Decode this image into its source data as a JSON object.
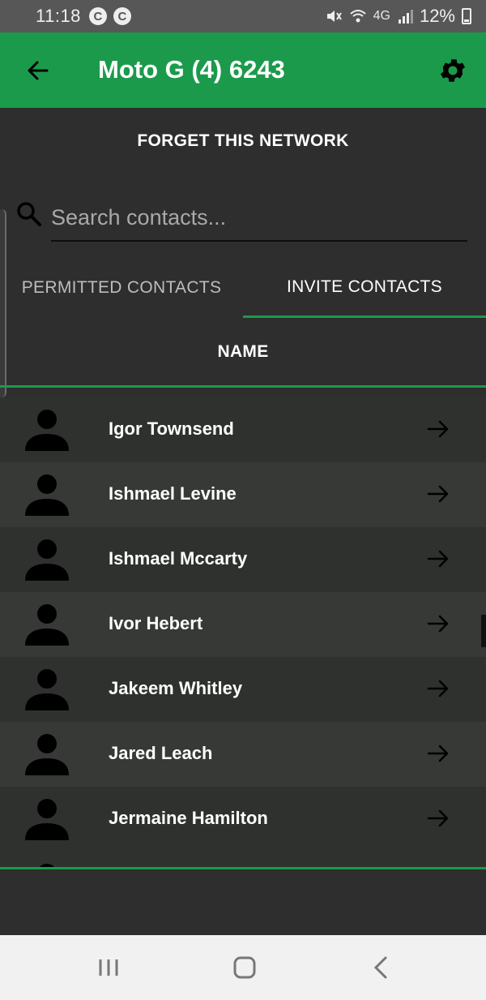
{
  "status_bar": {
    "time": "11:18",
    "network": "4G",
    "battery": "12%",
    "icons": [
      "c-notification-icon",
      "c-notification-icon",
      "mute-icon",
      "wifi-icon",
      "signal-icon",
      "battery-charging-icon"
    ]
  },
  "app_bar": {
    "title": "Moto G (4) 6243",
    "color": "#1b9a4b",
    "icons": [
      "back-arrow-icon",
      "gear-icon"
    ]
  },
  "forget_button": {
    "label": "FORGET THIS NETWORK"
  },
  "search": {
    "placeholder": "Search contacts...",
    "value": ""
  },
  "tabs": [
    {
      "label": "PERMITTED CONTACTS",
      "selected": false
    },
    {
      "label": "INVITE CONTACTS",
      "selected": true
    }
  ],
  "column_header": "NAME",
  "contacts": [
    {
      "name": "Igor Townsend"
    },
    {
      "name": "Ishmael Levine"
    },
    {
      "name": "Ishmael Mccarty"
    },
    {
      "name": "Ivor Hebert"
    },
    {
      "name": "Jakeem Whitley"
    },
    {
      "name": "Jared Leach"
    },
    {
      "name": "Jermaine Hamilton"
    }
  ],
  "nav_bar": {
    "icons": [
      "recents-icon",
      "home-icon",
      "back-icon"
    ]
  }
}
